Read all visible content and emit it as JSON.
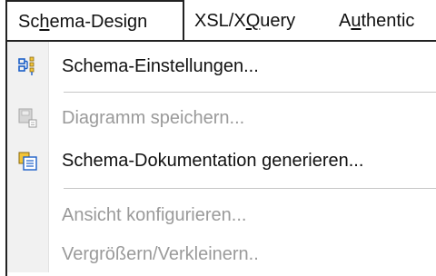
{
  "menubar": {
    "items": [
      {
        "pre": "Sc",
        "u": "h",
        "post": "ema-Design"
      },
      {
        "pre": "XSL/X",
        "u": "Q",
        "post": "uery"
      },
      {
        "pre": "A",
        "u": "u",
        "post": "thentic"
      }
    ]
  },
  "menu": {
    "items": [
      {
        "label": "Schema-Einstellungen...",
        "enabled": true,
        "icon": "schema-settings-icon"
      },
      {
        "label": "Diagramm speichern...",
        "enabled": false,
        "icon": "save-diagram-icon"
      },
      {
        "label": "Schema-Dokumentation generieren...",
        "enabled": true,
        "icon": "generate-documentation-icon"
      },
      {
        "label": "Ansicht konfigurieren...",
        "enabled": false,
        "icon": null
      },
      {
        "label": "Vergrößern/Verkleinern..",
        "enabled": false,
        "icon": null
      }
    ]
  },
  "colors": {
    "text": "#111111",
    "disabled_text": "#9a9a9a",
    "icon_blue": "#1c5fc8",
    "icon_yellow": "#f2c438"
  }
}
